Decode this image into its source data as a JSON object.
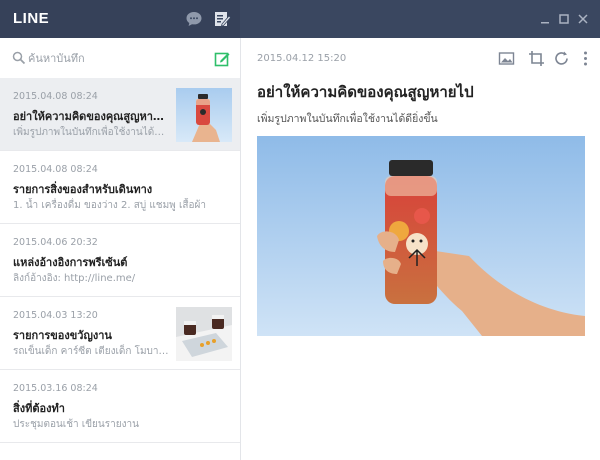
{
  "app": {
    "logo": "LINE"
  },
  "search": {
    "placeholder": "ค้นหาบันทึก"
  },
  "notes": [
    {
      "date": "2015.04.08  08:24",
      "title": "อย่าให้ความคิดของคุณสูญหายไป",
      "preview": "เพิ่มรูปภาพในบันทึกเพื่อใช้งานได้ดียิ่...",
      "thumb": "bottle"
    },
    {
      "date": "2015.04.08  08:24",
      "title": "รายการสิ่งของสำหรับเดินทาง",
      "preview": "1. น้ำ เครื่องดื่ม ของว่าง   2. สบู่ แชมพู เสื้อผ้า"
    },
    {
      "date": "2015.04.06  20:32",
      "title": "แหล่งอ้างอิงการพรีเซ้นต์",
      "preview": "ลิงก์อ้างอิง: http://line.me/"
    },
    {
      "date": "2015.04.03  13:20",
      "title": "รายการของขวัญงาน",
      "preview": "รถเข็นเด็ก คาร์ซีต เตียงเด็ก โมบาย...",
      "thumb": "cups"
    },
    {
      "date": "2015.03.16  08:24",
      "title": "สิ่งที่ต้องทำ",
      "preview": "ประชุมตอนเช้า เขียนรายงาน"
    }
  ],
  "detail": {
    "date": "2015.04.12  15:20",
    "title": "อย่าให้ความคิดของคุณสูญหายไป",
    "body": "เพิ่มรูปภาพในบันทึกเพื่อใช้งานได้ดียิ่งขึ้น"
  },
  "colors": {
    "titlebar": "#3a4760",
    "accent_green": "#2fbf6a",
    "selected_row": "#eceef1"
  }
}
